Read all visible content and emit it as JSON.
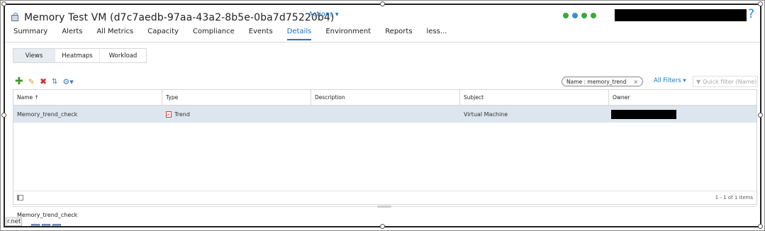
{
  "header": {
    "title": "Memory Test VM (d7c7aedb-97aa-43a2-8b5e-0ba7d75220b4)",
    "actions_label": "Actions ▾",
    "help": "?",
    "status_colors": [
      "#3aa83a",
      "#3a8fd4",
      "#3aa83a",
      "#3aa83a"
    ]
  },
  "tabs": [
    "Summary",
    "Alerts",
    "All Metrics",
    "Capacity",
    "Compliance",
    "Events",
    "Details",
    "Environment",
    "Reports",
    "less..."
  ],
  "active_tab": "Details",
  "subtabs": [
    "Views",
    "Heatmaps",
    "Workload"
  ],
  "active_subtab": "Views",
  "filter": {
    "chip_label": "Name : memory_trend",
    "chip_close": "×",
    "all_filters": "All Filters ▾",
    "quick_filter_placeholder": "Quick filter (Name)"
  },
  "grid": {
    "columns": [
      "Name ↑",
      "Type",
      "Description",
      "Subject",
      "Owner"
    ],
    "rows": [
      {
        "name": "Memory_trend_check",
        "type": "Trend",
        "description": "",
        "subject": "Virtual Machine",
        "owner": ""
      }
    ],
    "footer": "1 - 1 of 1 items"
  },
  "detail": {
    "selected_name": "Memory_trend_check"
  },
  "overlay_label": "r.net"
}
